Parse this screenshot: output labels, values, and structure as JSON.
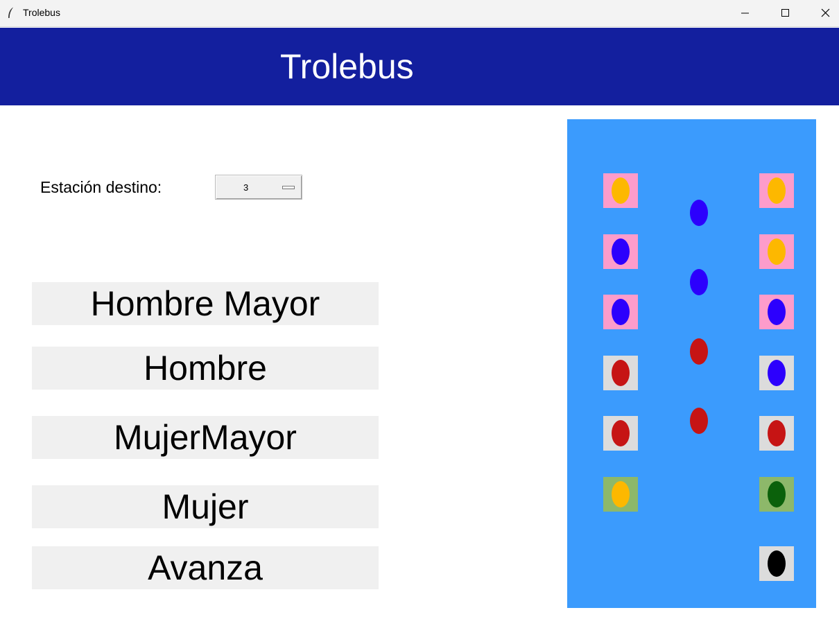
{
  "window": {
    "title": "Trolebus",
    "controls": [
      "minimize",
      "maximize",
      "close"
    ]
  },
  "header": {
    "title": "Trolebus"
  },
  "destination": {
    "label": "Estación destino:",
    "value": "3"
  },
  "buttons": [
    {
      "id": "hombre-mayor",
      "label": "Hombre Mayor"
    },
    {
      "id": "hombre",
      "label": "Hombre"
    },
    {
      "id": "mujer-mayor",
      "label": "MujerMayor"
    },
    {
      "id": "mujer",
      "label": "Mujer"
    },
    {
      "id": "avanza",
      "label": "Avanza"
    }
  ],
  "colors": {
    "header": "#131f9e",
    "bus_floor": "#3b9bfd",
    "seat_pink": "#fd9ccb",
    "seat_grey": "#dcdcdc",
    "seat_green": "#8db86a",
    "passenger_yellow": "#fdb800",
    "passenger_blue": "#2c00fd",
    "passenger_red": "#c61414",
    "passenger_darkgreen": "#0b610b",
    "passenger_black": "#000000"
  },
  "bus": {
    "left_seats": [
      {
        "seat": "pink",
        "passenger": "yellow"
      },
      {
        "seat": "pink",
        "passenger": "blue"
      },
      {
        "seat": "pink",
        "passenger": "blue"
      },
      {
        "seat": "grey",
        "passenger": "red"
      },
      {
        "seat": "grey",
        "passenger": "red"
      },
      {
        "seat": "green",
        "passenger": "yellow"
      }
    ],
    "right_seats": [
      {
        "seat": "pink",
        "passenger": "yellow"
      },
      {
        "seat": "pink",
        "passenger": "yellow"
      },
      {
        "seat": "pink",
        "passenger": "blue"
      },
      {
        "seat": "grey",
        "passenger": "blue"
      },
      {
        "seat": "grey",
        "passenger": "red"
      },
      {
        "seat": "green",
        "passenger": "darkgreen"
      },
      {
        "seat": "grey",
        "passenger": "black"
      }
    ],
    "aisle_passengers": [
      "blue",
      "blue",
      "red",
      "red"
    ]
  }
}
